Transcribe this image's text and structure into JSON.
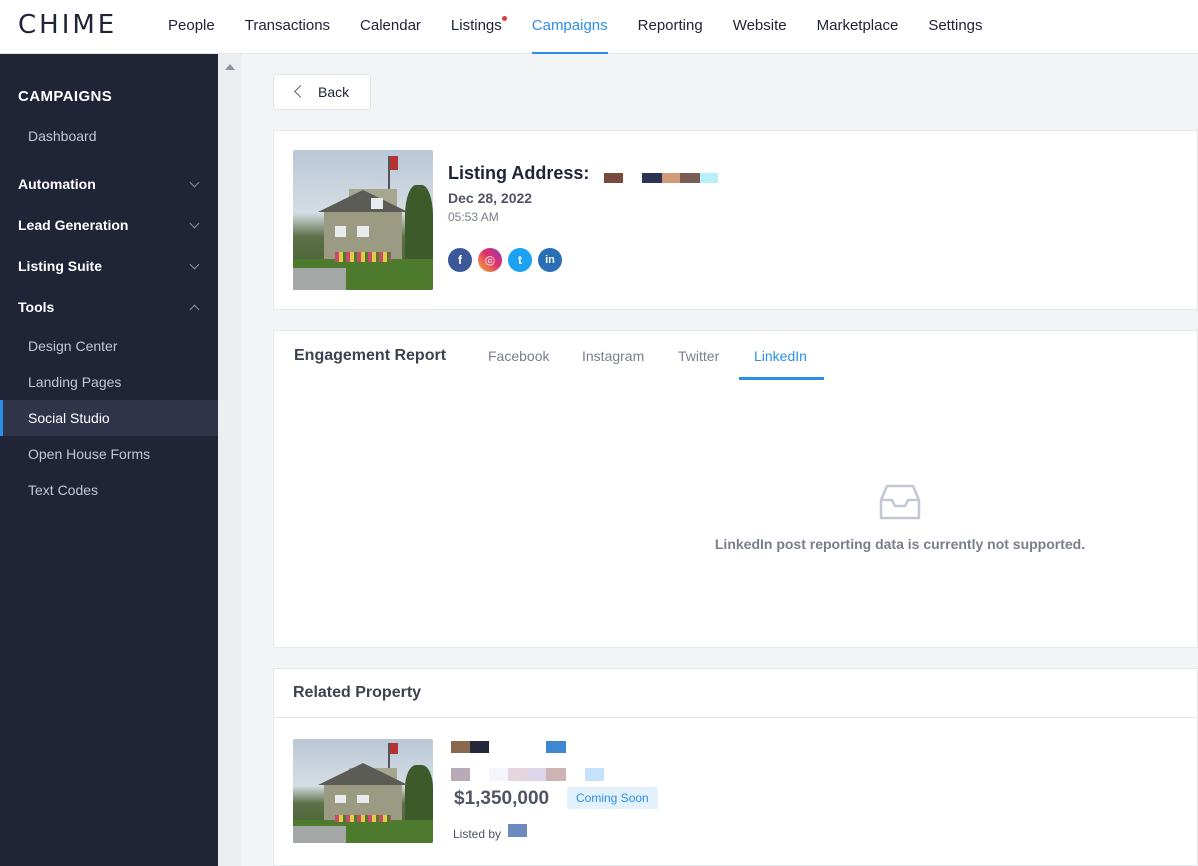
{
  "app": {
    "logo": "CHIME"
  },
  "nav": {
    "items": [
      {
        "label": "People"
      },
      {
        "label": "Transactions"
      },
      {
        "label": "Calendar"
      },
      {
        "label": "Listings"
      },
      {
        "label": "Campaigns"
      },
      {
        "label": "Reporting"
      },
      {
        "label": "Website"
      },
      {
        "label": "Marketplace"
      },
      {
        "label": "Settings"
      }
    ]
  },
  "sidebar": {
    "title": "CAMPAIGNS",
    "dashboard": "Dashboard",
    "groups": [
      {
        "label": "Automation"
      },
      {
        "label": "Lead Generation"
      },
      {
        "label": "Listing Suite"
      },
      {
        "label": "Tools"
      }
    ],
    "tools": [
      {
        "label": "Design Center"
      },
      {
        "label": "Landing Pages"
      },
      {
        "label": "Social Studio"
      },
      {
        "label": "Open House Forms"
      },
      {
        "label": "Text Codes"
      }
    ]
  },
  "back_label": "Back",
  "listing": {
    "title": "Listing Address:",
    "date": "Dec 28, 2022",
    "time": "05:53 AM"
  },
  "social": {
    "facebook": "f",
    "instagram": "◎",
    "twitter": "t",
    "linkedin": "in"
  },
  "engagement": {
    "title": "Engagement Report",
    "tabs": [
      {
        "label": "Facebook"
      },
      {
        "label": "Instagram"
      },
      {
        "label": "Twitter"
      },
      {
        "label": "LinkedIn"
      }
    ],
    "empty_message": "LinkedIn post reporting data is currently not supported."
  },
  "related": {
    "title": "Related Property",
    "price": "$1,350,000",
    "badge": "Coming Soon",
    "listed_by": "Listed by"
  },
  "colors": {
    "accent": "#2d8ee7",
    "sidebar_bg": "#202437",
    "facebook": "#3b5998",
    "twitter": "#1da1f2",
    "linkedin": "#2a6fb5"
  }
}
